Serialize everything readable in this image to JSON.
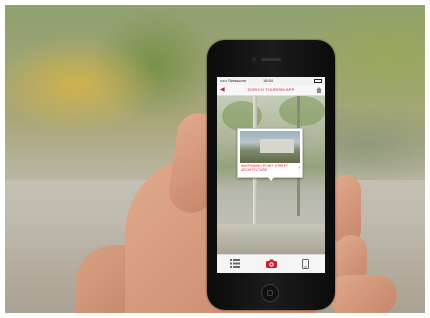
{
  "status_bar": {
    "carrier": "••••• Swisscom",
    "time": "18:54"
  },
  "nav_bar": {
    "title": "ZÜRICH TOURISM APP",
    "back_icon": "chevron-left-icon",
    "home_icon": "home-icon"
  },
  "popup": {
    "text_line1": "WAYFINDING POINT: STREET",
    "text_line2": "ARCHITECTURE",
    "chevron_icon": "chevron-right-icon"
  },
  "tab_bar": {
    "tabs": [
      {
        "icon": "list-icon",
        "active": false
      },
      {
        "icon": "camera-icon",
        "active": true
      },
      {
        "icon": "phone-device-icon",
        "active": false
      }
    ]
  },
  "colors": {
    "accent": "#c82030"
  }
}
